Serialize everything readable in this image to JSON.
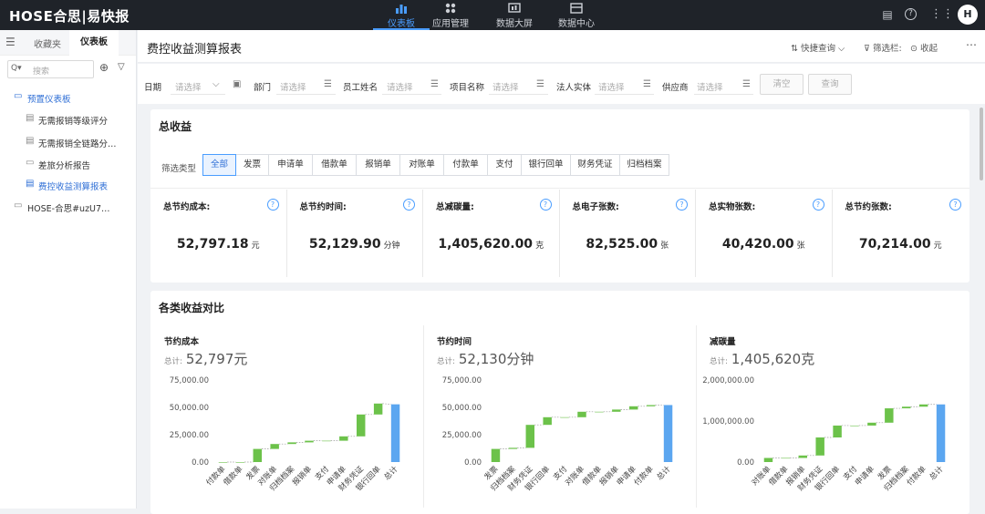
{
  "topbar": {
    "logo": "HOSE合思|易快报",
    "nav": [
      {
        "label": "仪表板",
        "icon": "bar-chart-icon",
        "active": true
      },
      {
        "label": "应用管理",
        "icon": "apps-icon",
        "active": false
      },
      {
        "label": "数据大屏",
        "icon": "dashboard-screen-icon",
        "active": false
      },
      {
        "label": "数据中心",
        "icon": "data-center-icon",
        "active": false
      }
    ],
    "avatar": "H"
  },
  "sidebar": {
    "tabs": [
      "收藏夹",
      "仪表板"
    ],
    "active_tab": "仪表板",
    "search_placeholder": "搜索",
    "tree": [
      {
        "label": "预置仪表板",
        "icon": "folder-open-icon",
        "level": 0,
        "highlight": true
      },
      {
        "label": "无需报销等级评分",
        "icon": "report-icon",
        "level": 1,
        "highlight": false
      },
      {
        "label": "无需报销全链路分…",
        "icon": "report-icon",
        "level": 1,
        "highlight": false
      },
      {
        "label": "差旅分析报告",
        "icon": "folder-icon",
        "level": 1,
        "highlight": false
      },
      {
        "label": "费控收益测算报表",
        "icon": "report-icon",
        "level": 1,
        "highlight": true
      },
      {
        "label": "HOSE-合思#uzU7…",
        "icon": "folder-icon",
        "level": 0,
        "highlight": false
      }
    ]
  },
  "header": {
    "title": "费控收益测算报表",
    "quick_query": "快捷查询",
    "filter_bar": "筛选栏:",
    "collapse": "收起"
  },
  "filters": {
    "fields": [
      {
        "label": "日期",
        "value": "请选择"
      },
      {
        "label": "部门",
        "value": "请选择"
      },
      {
        "label": "员工姓名",
        "value": "请选择"
      },
      {
        "label": "项目名称",
        "value": "请选择"
      },
      {
        "label": "法人实体",
        "value": "请选择"
      },
      {
        "label": "供应商",
        "value": "请选择"
      }
    ],
    "clear": "清空",
    "query": "查询"
  },
  "total_card": {
    "title": "总收益",
    "filter_type_label": "筛选类型",
    "filter_tabs": [
      "全部",
      "发票",
      "申请单",
      "借款单",
      "报销单",
      "对账单",
      "付款单",
      "支付",
      "银行回单",
      "财务凭证",
      "归档档案"
    ],
    "active_filter": "全部",
    "metrics": [
      {
        "label": "总节约成本:",
        "value": "52,797.18",
        "unit": "元"
      },
      {
        "label": "总节约时间:",
        "value": "52,129.90",
        "unit": "分钟"
      },
      {
        "label": "总减碳量:",
        "value": "1,405,620.00",
        "unit": "克"
      },
      {
        "label": "总电子张数:",
        "value": "82,525.00",
        "unit": "张"
      },
      {
        "label": "总实物张数:",
        "value": "40,420.00",
        "unit": "张"
      },
      {
        "label": "总节约张数:",
        "value": "70,214.00",
        "unit": "元"
      }
    ]
  },
  "compare_card": {
    "title": "各类收益对比"
  },
  "chart_data": [
    {
      "type": "bar",
      "subtype": "waterfall",
      "title": "节约成本",
      "total_label": "总计:",
      "total_display": "52,797元",
      "ylim": [
        0,
        75000
      ],
      "yticks": [
        "0.00",
        "25,000.00",
        "50,000.00",
        "75,000.00"
      ],
      "categories": [
        "付款单",
        "借款单",
        "发票",
        "对账单",
        "归档档案",
        "报销单",
        "支付",
        "申请单",
        "财务凭证",
        "银行回单",
        "总计"
      ],
      "values": [
        0,
        0,
        12000,
        4500,
        1500,
        1500,
        0,
        4000,
        20000,
        10000,
        52797
      ],
      "colors": {
        "increase": "#6cc24a",
        "total": "#5ba6f0"
      }
    },
    {
      "type": "bar",
      "subtype": "waterfall",
      "title": "节约时间",
      "total_label": "总计:",
      "total_display": "52,130分钟",
      "ylim": [
        0,
        75000
      ],
      "yticks": [
        "0.00",
        "25,000.00",
        "50,000.00",
        "75,000.00"
      ],
      "categories": [
        "发票",
        "归档档案",
        "财务凭证",
        "银行回单",
        "支付",
        "对账单",
        "借款单",
        "报销单",
        "申请单",
        "付款单",
        "总计"
      ],
      "values": [
        12000,
        1000,
        21000,
        7000,
        0,
        5000,
        0,
        2000,
        3000,
        1100,
        52130
      ],
      "colors": {
        "increase": "#6cc24a",
        "total": "#5ba6f0"
      }
    },
    {
      "type": "bar",
      "subtype": "waterfall",
      "title": "减碳量",
      "total_label": "总计:",
      "total_display": "1,405,620克",
      "ylim": [
        0,
        2000000
      ],
      "yticks": [
        "0.00",
        "1,000,000.00",
        "2,000,000.00"
      ],
      "categories": [
        "对账单",
        "借款单",
        "报销单",
        "财务凭证",
        "银行回单",
        "支付",
        "申请单",
        "发票",
        "归档档案",
        "付款单",
        "总计"
      ],
      "values": [
        100000,
        0,
        60000,
        440000,
        290000,
        0,
        70000,
        350000,
        40000,
        55620,
        1405620
      ],
      "colors": {
        "increase": "#6cc24a",
        "total": "#5ba6f0"
      }
    }
  ]
}
